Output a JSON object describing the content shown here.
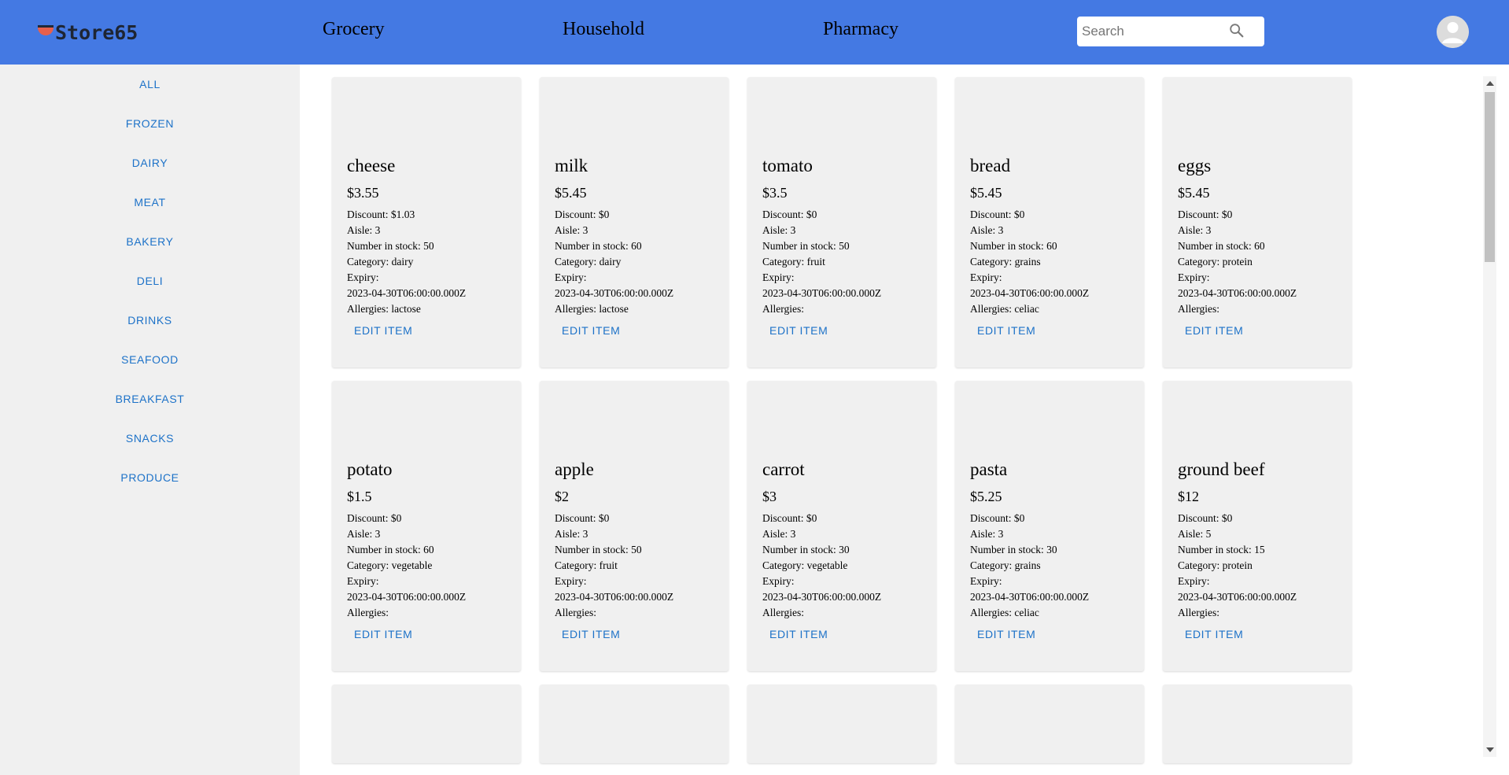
{
  "header": {
    "logo_text": "Store65",
    "nav": [
      "Grocery",
      "Household",
      "Pharmacy"
    ],
    "search_placeholder": "Search"
  },
  "sidebar": {
    "categories": [
      "ALL",
      "FROZEN",
      "DAIRY",
      "MEAT",
      "BAKERY",
      "DELI",
      "DRINKS",
      "SEAFOOD",
      "BREAKFAST",
      "SNACKS",
      "PRODUCE"
    ]
  },
  "labels": {
    "discount": "Discount: ",
    "aisle": "Aisle: ",
    "stock": "Number in stock: ",
    "category": "Category: ",
    "expiry": "Expiry:",
    "allergies": "Allergies: ",
    "edit": "EDIT ITEM"
  },
  "products": [
    {
      "name": "cheese",
      "price": "$3.55",
      "discount": "$1.03",
      "aisle": "3",
      "stock": "50",
      "category": "dairy",
      "expiry": "2023-04-30T06:00:00.000Z",
      "allergies": "lactose"
    },
    {
      "name": "milk",
      "price": "$5.45",
      "discount": "$0",
      "aisle": "3",
      "stock": "60",
      "category": "dairy",
      "expiry": "2023-04-30T06:00:00.000Z",
      "allergies": "lactose"
    },
    {
      "name": "tomato",
      "price": "$3.5",
      "discount": "$0",
      "aisle": "3",
      "stock": "50",
      "category": "fruit",
      "expiry": "2023-04-30T06:00:00.000Z",
      "allergies": ""
    },
    {
      "name": "bread",
      "price": "$5.45",
      "discount": "$0",
      "aisle": "3",
      "stock": "60",
      "category": "grains",
      "expiry": "2023-04-30T06:00:00.000Z",
      "allergies": "celiac"
    },
    {
      "name": "eggs",
      "price": "$5.45",
      "discount": "$0",
      "aisle": "3",
      "stock": "60",
      "category": "protein",
      "expiry": "2023-04-30T06:00:00.000Z",
      "allergies": ""
    },
    {
      "name": "potato",
      "price": "$1.5",
      "discount": "$0",
      "aisle": "3",
      "stock": "60",
      "category": "vegetable",
      "expiry": "2023-04-30T06:00:00.000Z",
      "allergies": ""
    },
    {
      "name": "apple",
      "price": "$2",
      "discount": "$0",
      "aisle": "3",
      "stock": "50",
      "category": "fruit",
      "expiry": "2023-04-30T06:00:00.000Z",
      "allergies": ""
    },
    {
      "name": "carrot",
      "price": "$3",
      "discount": "$0",
      "aisle": "3",
      "stock": "30",
      "category": "vegetable",
      "expiry": "2023-04-30T06:00:00.000Z",
      "allergies": ""
    },
    {
      "name": "pasta",
      "price": "$5.25",
      "discount": "$0",
      "aisle": "3",
      "stock": "30",
      "category": "grains",
      "expiry": "2023-04-30T06:00:00.000Z",
      "allergies": "celiac"
    },
    {
      "name": "ground beef",
      "price": "$12",
      "discount": "$0",
      "aisle": "5",
      "stock": "15",
      "category": "protein",
      "expiry": "2023-04-30T06:00:00.000Z",
      "allergies": ""
    }
  ],
  "colors": {
    "header_bg": "#4479e3",
    "accent": "#1d72c8",
    "card_bg": "#f0f0f0",
    "sidebar_bg": "#f0f0f0"
  },
  "icons": {
    "search": "search-icon",
    "avatar": "account-circle-icon",
    "logo": "store-logo-icon"
  }
}
